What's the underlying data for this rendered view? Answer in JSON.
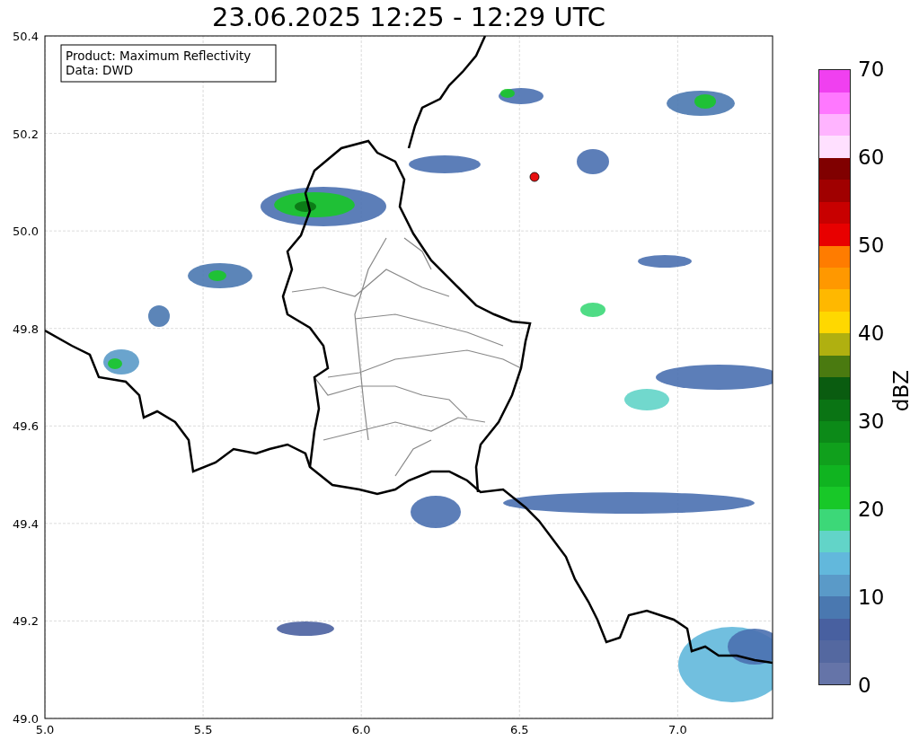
{
  "title": "23.06.2025 12:25 - 12:29 UTC",
  "legend": [
    "Product: Maximum Reflectivity",
    "Data: DWD"
  ],
  "map": {
    "xticks": [
      "5.0",
      "5.5",
      "6.0",
      "6.5",
      "7.0"
    ],
    "yticks": [
      "50.4",
      "50.2",
      "50.0",
      "49.8",
      "49.6",
      "49.4",
      "49.2",
      "49.0"
    ]
  },
  "colorbar": {
    "label": "dBZ",
    "ticks": [
      "70",
      "60",
      "50",
      "40",
      "30",
      "20",
      "10",
      "0"
    ],
    "segments": [
      {
        "color": "#6574a8"
      },
      {
        "color": "#5468a0"
      },
      {
        "color": "#4860a0"
      },
      {
        "color": "#4a78b0"
      },
      {
        "color": "#5a9ac8"
      },
      {
        "color": "#62b8dc"
      },
      {
        "color": "#62d4c8"
      },
      {
        "color": "#3cd878"
      },
      {
        "color": "#18c828"
      },
      {
        "color": "#10b420"
      },
      {
        "color": "#10a01c"
      },
      {
        "color": "#0c8a18"
      },
      {
        "color": "#0a7414"
      },
      {
        "color": "#0a5c10"
      },
      {
        "color": "#4a7a10"
      },
      {
        "color": "#b0b010"
      },
      {
        "color": "#ffd800"
      },
      {
        "color": "#ffb800"
      },
      {
        "color": "#ff9800"
      },
      {
        "color": "#ff7c00"
      },
      {
        "color": "#e80000"
      },
      {
        "color": "#c80000"
      },
      {
        "color": "#a00000"
      },
      {
        "color": "#800000"
      },
      {
        "color": "#ffe0ff"
      },
      {
        "color": "#ffb4ff"
      },
      {
        "color": "#ff78ff"
      },
      {
        "color": "#f040f0"
      }
    ]
  }
}
